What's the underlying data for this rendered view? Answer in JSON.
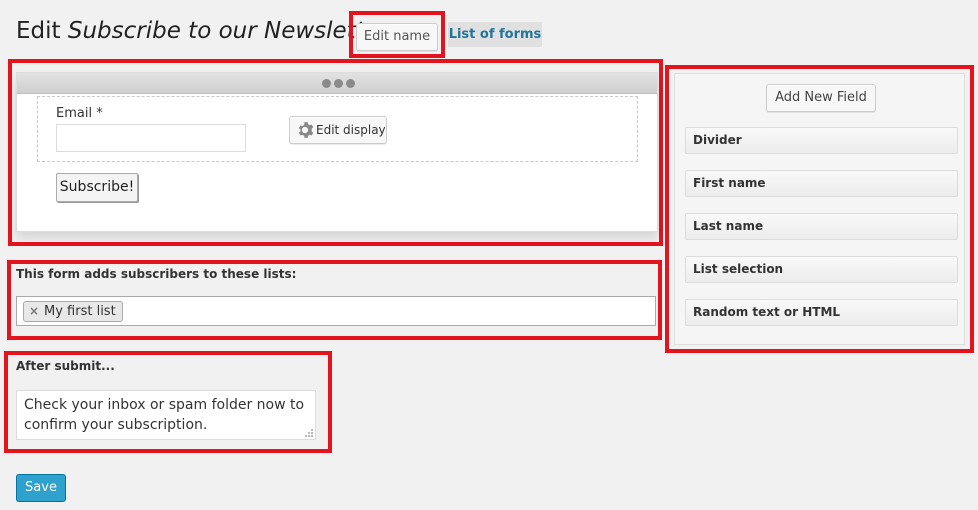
{
  "header": {
    "title_prefix": "Edit",
    "form_name": "Subscribe to our Newsletter",
    "edit_name_label": "Edit name",
    "list_of_forms_label": "List of forms"
  },
  "preview": {
    "email_label": "Email *",
    "email_value": "",
    "edit_display_label": "Edit display",
    "subscribe_label": "Subscribe!"
  },
  "lists": {
    "label": "This form adds subscribers to these lists:",
    "selected": [
      {
        "name": "My first list"
      }
    ]
  },
  "after_submit": {
    "label": "After submit...",
    "message": "Check your inbox or spam folder now to confirm your subscription."
  },
  "save_label": "Save",
  "fields_panel": {
    "add_new_field_label": "Add New Field",
    "items": [
      {
        "label": "Divider"
      },
      {
        "label": "First name"
      },
      {
        "label": "Last name"
      },
      {
        "label": "List selection"
      },
      {
        "label": "Random text or HTML"
      }
    ]
  },
  "colors": {
    "highlight": "#e3141e",
    "primary_button": "#2ea2cc",
    "link": "#21759b"
  }
}
